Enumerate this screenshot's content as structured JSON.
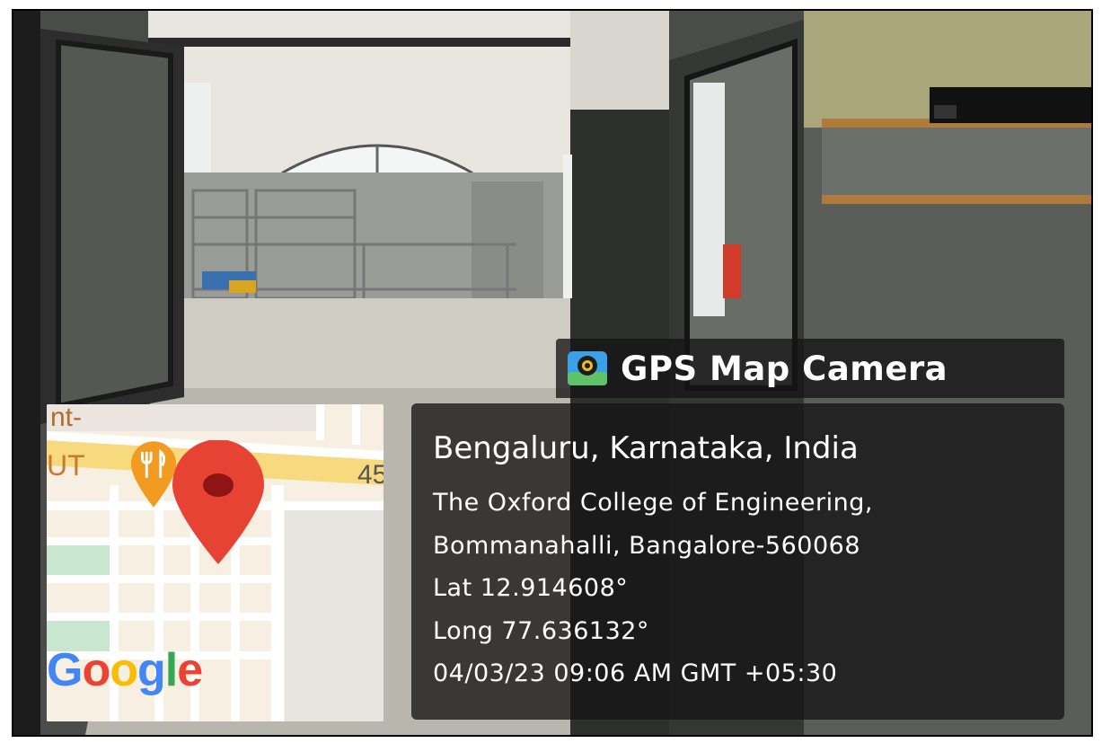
{
  "watermark": {
    "app_name": "GPS Map Camera",
    "icon": "gps-camera-app-icon"
  },
  "location": {
    "city_line": "Bengaluru, Karnataka, India",
    "address_line_1": "The Oxford College of Engineering,",
    "address_line_2": "Bommanahalli, Bangalore-560068",
    "latitude": "Lat 12.914608°",
    "longitude": "Long 77.636132°",
    "datetime": "04/03/23 09:06 AM GMT +05:30"
  },
  "map": {
    "road_number": "45",
    "label_fragment_1": "nt-",
    "label_fragment_2": "UT",
    "provider_logo": "Google",
    "pin_icon": "map-pin-icon",
    "poi_icon": "restaurant-pin-icon",
    "colors": {
      "pin": "#e74335",
      "poi": "#f29b21",
      "road": "#ffffff",
      "block": "#f7efe2",
      "park": "#c9e6cf"
    }
  }
}
